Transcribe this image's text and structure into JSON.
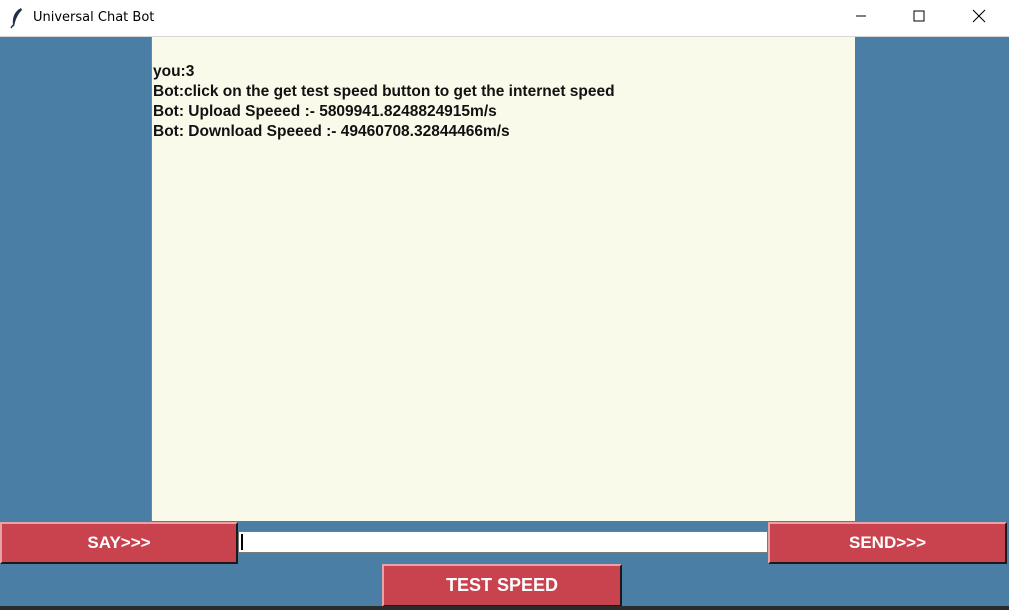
{
  "window": {
    "title": "Universal Chat Bot"
  },
  "chat": {
    "lines": [
      "you:3",
      "Bot:click on the get test speed button to get the internet speed",
      "Bot: Upload Speeed :- 5809941.8248824915m/s",
      "Bot: Download Speeed :- 49460708.32844466m/s"
    ]
  },
  "controls": {
    "say_label": "SAY>>>",
    "send_label": "SEND>>>",
    "test_speed_label": "TEST SPEED",
    "input_value": ""
  },
  "colors": {
    "background": "#4a7ea5",
    "chat_background": "#fafaeb",
    "button": "#c9434f"
  },
  "icons": {
    "app": "feather-icon",
    "minimize": "minimize-icon",
    "maximize": "maximize-icon",
    "close": "close-icon"
  }
}
